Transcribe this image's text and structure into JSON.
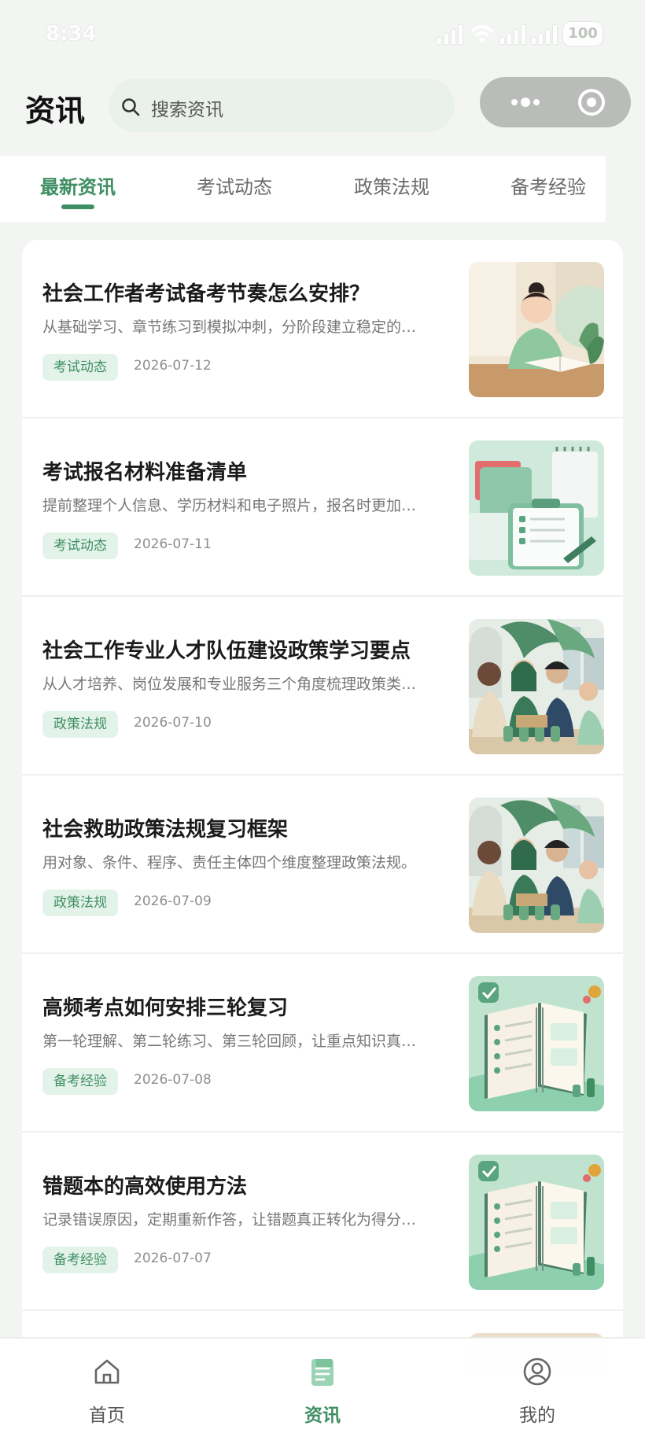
{
  "status_bar": {
    "time": "8:34",
    "battery": "100"
  },
  "header": {
    "title": "资讯",
    "search_placeholder": "搜索资讯"
  },
  "tabs": [
    {
      "label": "最新资讯",
      "active": true
    },
    {
      "label": "考试动态",
      "active": false
    },
    {
      "label": "政策法规",
      "active": false
    },
    {
      "label": "备考经验",
      "active": false
    }
  ],
  "articles": [
    {
      "title": "社会工作者考试备考节奏怎么安排？",
      "summary": "从基础学习、章节练习到模拟冲刺，分阶段建立稳定的…",
      "tag": "考试动态",
      "date": "2026-07-12",
      "thumbnail": "student-studying-illustration"
    },
    {
      "title": "考试报名材料准备清单",
      "summary": "提前整理个人信息、学历材料和电子照片，报名时更加…",
      "tag": "考试动态",
      "date": "2026-07-11",
      "thumbnail": "clipboard-checklist-illustration"
    },
    {
      "title": "社会工作专业人才队伍建设政策学习要点",
      "summary": "从人才培养、岗位发展和专业服务三个角度梳理政策类…",
      "tag": "政策法规",
      "date": "2026-07-10",
      "thumbnail": "community-group-illustration"
    },
    {
      "title": "社会救助政策法规复习框架",
      "summary": "用对象、条件、程序、责任主体四个维度整理政策法规。",
      "tag": "政策法规",
      "date": "2026-07-09",
      "thumbnail": "community-group-illustration"
    },
    {
      "title": "高频考点如何安排三轮复习",
      "summary": "第一轮理解、第二轮练习、第三轮回顾，让重点知识真…",
      "tag": "备考经验",
      "date": "2026-07-08",
      "thumbnail": "notebook-checklist-illustration"
    },
    {
      "title": "错题本的高效使用方法",
      "summary": "记录错误原因，定期重新作答，让错题真正转化为得分…",
      "tag": "备考经验",
      "date": "2026-07-07",
      "thumbnail": "notebook-checklist-illustration"
    }
  ],
  "bottom_nav": [
    {
      "label": "首页",
      "icon": "home-icon",
      "active": false
    },
    {
      "label": "资讯",
      "icon": "news-icon",
      "active": true
    },
    {
      "label": "我的",
      "icon": "profile-icon",
      "active": false
    }
  ],
  "colors": {
    "accent": "#3f8f63",
    "tag_bg": "#e4f3ea",
    "page_bg": "#f3f5f3"
  }
}
